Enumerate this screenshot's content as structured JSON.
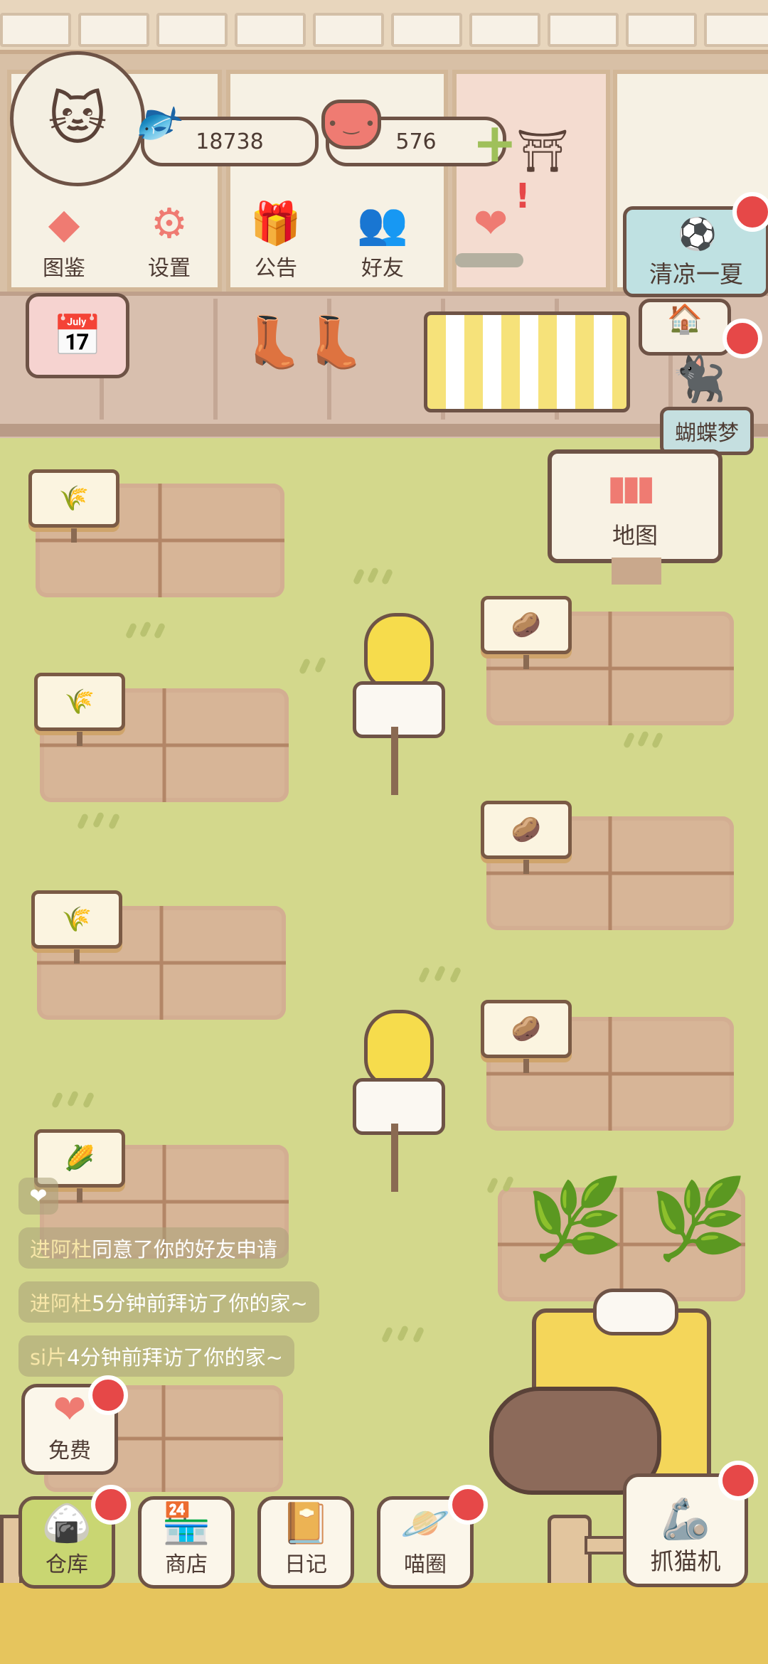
{
  "resources": {
    "fish_count": "18738",
    "heart_count": "576"
  },
  "top_menu": [
    {
      "label": "图鉴",
      "icon": "cat-head-icon"
    },
    {
      "label": "设置",
      "icon": "gear-icon"
    },
    {
      "label": "公告",
      "icon": "gift-icon"
    },
    {
      "label": "好友",
      "icon": "friends-icon"
    }
  ],
  "events": {
    "summer_banner": "清凉一夏",
    "butterfly_dream": "蝴蝶梦"
  },
  "map_sign": "地图",
  "chat": [
    {
      "name": "进阿杜",
      "text": "同意了你的好友申请"
    },
    {
      "name": "进阿杜",
      "text": "5分钟前拜访了你的家~"
    },
    {
      "name": "si片",
      "text": "4分钟前拜访了你的家~"
    }
  ],
  "free_button": "免费",
  "bottom_nav": [
    {
      "label": "仓库",
      "icon": "warehouse-icon"
    },
    {
      "label": "商店",
      "icon": "shop-icon"
    },
    {
      "label": "日记",
      "icon": "diary-icon"
    },
    {
      "label": "喵圈",
      "icon": "cat-planet-icon"
    }
  ],
  "claw_machine": "抓猫机",
  "colors": {
    "grass": "#d3d88c",
    "accent_red": "#e64848",
    "soil": "#d7b597"
  }
}
